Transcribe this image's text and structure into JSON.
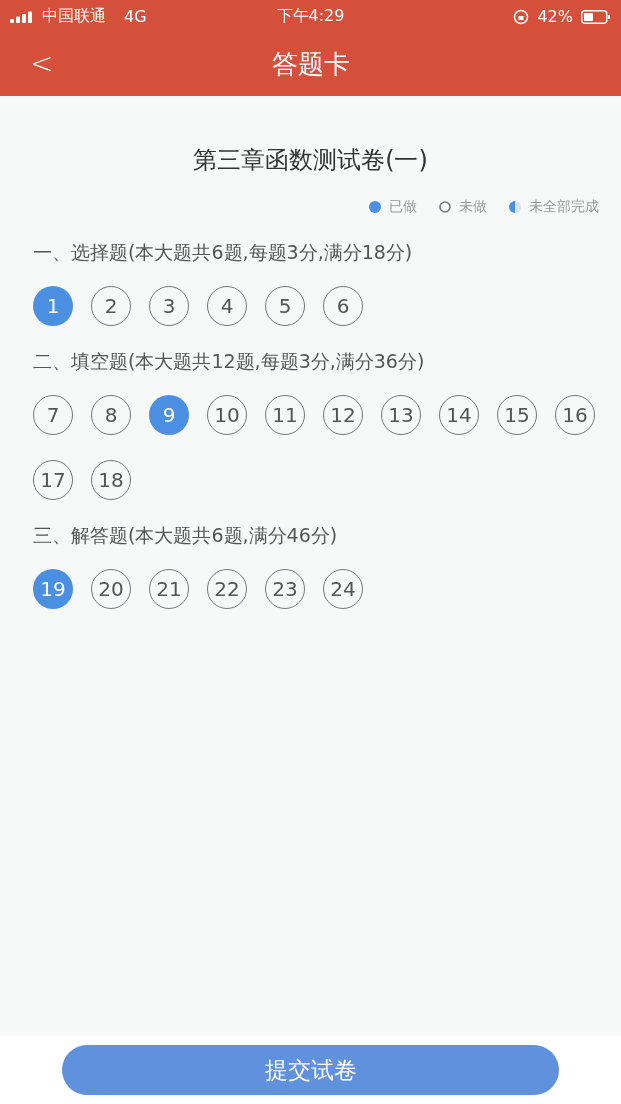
{
  "status_bar": {
    "carrier": "中国联通",
    "network": "4G",
    "time": "下午4:29",
    "battery": "42%"
  },
  "header": {
    "back": "<",
    "title": "答题卡"
  },
  "paper_title": "第三章函数测试卷(一)",
  "legend": [
    {
      "kind": "done",
      "label": "已做"
    },
    {
      "kind": "undone",
      "label": "未做"
    },
    {
      "kind": "partial",
      "label": "未全部完成"
    }
  ],
  "sections": [
    {
      "heading": "一、选择题(本大题共6题,每题3分,满分18分)",
      "questions": [
        {
          "number": "1",
          "answered": true
        },
        {
          "number": "2",
          "answered": false
        },
        {
          "number": "3",
          "answered": false
        },
        {
          "number": "4",
          "answered": false
        },
        {
          "number": "5",
          "answered": false
        },
        {
          "number": "6",
          "answered": false
        }
      ]
    },
    {
      "heading": "二、填空题(本大题共12题,每题3分,满分36分)",
      "questions": [
        {
          "number": "7",
          "answered": false
        },
        {
          "number": "8",
          "answered": false
        },
        {
          "number": "9",
          "answered": true
        },
        {
          "number": "10",
          "answered": false
        },
        {
          "number": "11",
          "answered": false
        },
        {
          "number": "12",
          "answered": false
        },
        {
          "number": "13",
          "answered": false
        },
        {
          "number": "14",
          "answered": false
        },
        {
          "number": "15",
          "answered": false
        },
        {
          "number": "16",
          "answered": false
        },
        {
          "number": "17",
          "answered": false
        },
        {
          "number": "18",
          "answered": false
        }
      ]
    },
    {
      "heading": "三、解答题(本大题共6题,满分46分)",
      "questions": [
        {
          "number": "19",
          "answered": true
        },
        {
          "number": "20",
          "answered": false
        },
        {
          "number": "21",
          "answered": false
        },
        {
          "number": "22",
          "answered": false
        },
        {
          "number": "23",
          "answered": false
        },
        {
          "number": "24",
          "answered": false
        }
      ]
    }
  ],
  "submit_button": "提交试卷"
}
